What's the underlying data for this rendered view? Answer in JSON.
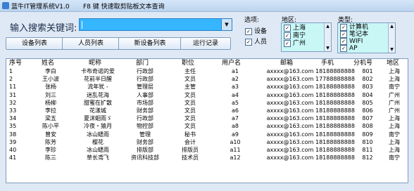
{
  "window": {
    "title": "蓝牛IT管理系统V1.0",
    "hint": "F8 键 快速取剪贴板文本查询"
  },
  "search": {
    "label": "输入搜索关键词:"
  },
  "buttons": {
    "device_list": "设备列表",
    "person_list": "人员列表",
    "new_device_list": "新设备列表",
    "run_log": "运行记录"
  },
  "options": {
    "label": "选项:",
    "items": [
      {
        "label": "设备",
        "checked": true
      },
      {
        "label": "人员",
        "checked": true
      }
    ]
  },
  "region": {
    "label": "地区:",
    "items": [
      {
        "label": "上海",
        "checked": true
      },
      {
        "label": "南宁",
        "checked": true
      },
      {
        "label": "广州",
        "checked": true
      }
    ]
  },
  "type": {
    "label": "类型:",
    "items": [
      {
        "label": "计算机",
        "checked": true
      },
      {
        "label": "笔记本",
        "checked": true
      },
      {
        "label": "WIFI",
        "checked": true
      },
      {
        "label": "AP",
        "checked": true
      }
    ]
  },
  "table": {
    "columns": [
      "序号",
      "姓名",
      "昵称",
      "部门",
      "职位",
      "用户名",
      "邮箱",
      "手机",
      "分机号",
      "地区"
    ],
    "rows": [
      [
        "1",
        "李白",
        "卡布奇诺的爱",
        "行政部",
        "主任",
        "a1",
        "axxxx@163.com",
        "18188888888",
        "801",
        "上海"
      ],
      [
        "2",
        "王小波",
        "花前半日醒",
        "行政部",
        "文员",
        "a2",
        "axxxx@163.com",
        "17788888888",
        "802",
        "上海"
      ],
      [
        "11",
        "张杨",
        "流年犹 -",
        "管理层",
        "主管",
        "a3",
        "axxxx@163.com",
        "18188888888",
        "803",
        "南宁"
      ],
      [
        "31",
        "刘三",
        "迷乱花海",
        "人事部",
        "文员",
        "a4",
        "axxxx@163.com",
        "18188888888",
        "804",
        "广州"
      ],
      [
        "32",
        "杨柳",
        "甜蜜在扩散",
        "市场部",
        "文员",
        "a5",
        "axxxx@163.com",
        "18188888888",
        "805",
        "广州"
      ],
      [
        "33",
        "李拉",
        "花漾城",
        "财务部",
        "文员",
        "a6",
        "axxxx@163.com",
        "18188888888",
        "806",
        "广州"
      ],
      [
        "34",
        "梁五",
        "夏沫蛔雨ゞ",
        "行政部",
        "文员",
        "a7",
        "axxxx@163.com",
        "18188888888",
        "807",
        "上海"
      ],
      [
        "35",
        "陈小平",
        "冷夜・猿月",
        "物控部",
        "文员",
        "a8",
        "axxxx@163.com",
        "18188888888",
        "808",
        "上海"
      ],
      [
        "38",
        "曾安",
        "冰山蟋雨",
        "管理",
        "秘书",
        "a9",
        "axxxx@163.com",
        "18188888888",
        "809",
        "南宁"
      ],
      [
        "39",
        "陈芳",
        "樱花",
        "财务部",
        "会计",
        "a10",
        "axxxx@163.com",
        "18188888888",
        "810",
        "上海"
      ],
      [
        "40",
        "李珍",
        "冰山蟋雨",
        "排版部",
        "排版员",
        "a11",
        "axxxx@163.com",
        "18188888888",
        "811",
        "上海"
      ],
      [
        "41",
        "陈三",
        "草长鸢飞",
        "资讯科技部",
        "技术员",
        "a12",
        "axxxx@163.com",
        "18188888888",
        "812",
        "南宁"
      ]
    ]
  }
}
